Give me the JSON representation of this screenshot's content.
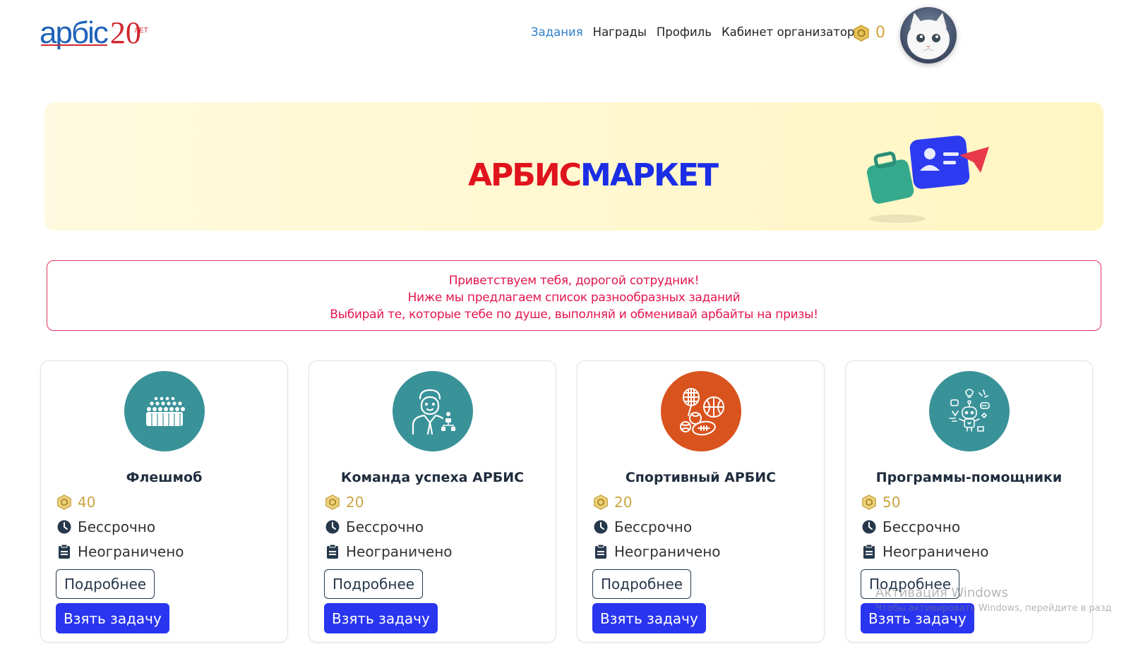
{
  "header": {
    "logo": {
      "word": "арбіс",
      "anniversary": "20",
      "anniversary_suffix": "ЛЕТ"
    },
    "nav": [
      {
        "label": "Задания",
        "active": true
      },
      {
        "label": "Награды",
        "active": false
      },
      {
        "label": "Профиль",
        "active": false
      },
      {
        "label": "Кабинет организатора",
        "active": false
      }
    ],
    "balance": {
      "icon": "coin-icon",
      "value": "0"
    },
    "avatar": {
      "icon": "cat-avatar"
    }
  },
  "banner": {
    "title_red": "АРБИС",
    "title_blue": "МАРКЕТ",
    "colors": {
      "red": "#e0141d",
      "blue": "#1b2ee6",
      "background": "#fff6c2"
    }
  },
  "greeting": {
    "lines": [
      "Приветствуем тебя, дорогой сотрудник!",
      "Ниже мы предлагаем список разнообразных заданий",
      "Выбирай те, которые тебе по душе, выполняй и обменивай арбайты на призы!"
    ],
    "color": "#e3164e"
  },
  "cards": [
    {
      "title": "Флешмоб",
      "reward": "40",
      "duration": "Бессрочно",
      "limit": "Неограничено",
      "more_label": "Подробнее",
      "take_label": "Взять задачу",
      "icon": "crowd-icon",
      "icon_color": "#3a9299"
    },
    {
      "title": "Команда успеха АРБИС",
      "reward": "20",
      "duration": "Бессрочно",
      "limit": "Неограничено",
      "more_label": "Подробнее",
      "take_label": "Взять задачу",
      "icon": "team-leader-icon",
      "icon_color": "#3a9299"
    },
    {
      "title": "Спортивный АРБИС",
      "reward": "20",
      "duration": "Бессрочно",
      "limit": "Неограничено",
      "more_label": "Подробнее",
      "take_label": "Взять задачу",
      "icon": "sports-balls-icon",
      "icon_color": "#d9531e"
    },
    {
      "title": "Программы-помощники",
      "reward": "50",
      "duration": "Бессрочно",
      "limit": "Неограничено",
      "more_label": "Подробнее",
      "take_label": "Взять задачу",
      "icon": "robot-assistant-icon",
      "icon_color": "#3a9299"
    }
  ],
  "watermark": {
    "line1": "Активация Windows",
    "line2": "Чтобы активировать Windows, перейдите в разд"
  }
}
